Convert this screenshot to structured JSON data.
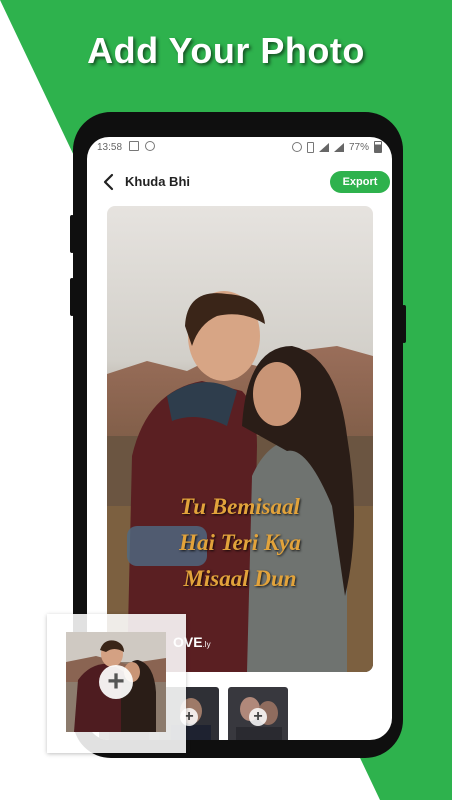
{
  "headline": "Add Your Photo",
  "status_bar": {
    "time": "13:58",
    "battery": "77%"
  },
  "app_bar": {
    "title": "Khuda Bhi",
    "export_label": "Export"
  },
  "photo": {
    "quote_lines": [
      "Tu Bemisaal",
      "Hai Teri Kya",
      "Misaal Dun"
    ],
    "watermark": "OVE",
    "watermark_suffix": ".ly"
  },
  "thumbnails": [
    {
      "icon": "plus-icon"
    },
    {
      "icon": "plus-icon"
    },
    {
      "icon": "plus-icon"
    }
  ],
  "colors": {
    "accent": "#2eb24d",
    "quote_text": "#e2a33b",
    "phone": "#0f0f0f"
  }
}
